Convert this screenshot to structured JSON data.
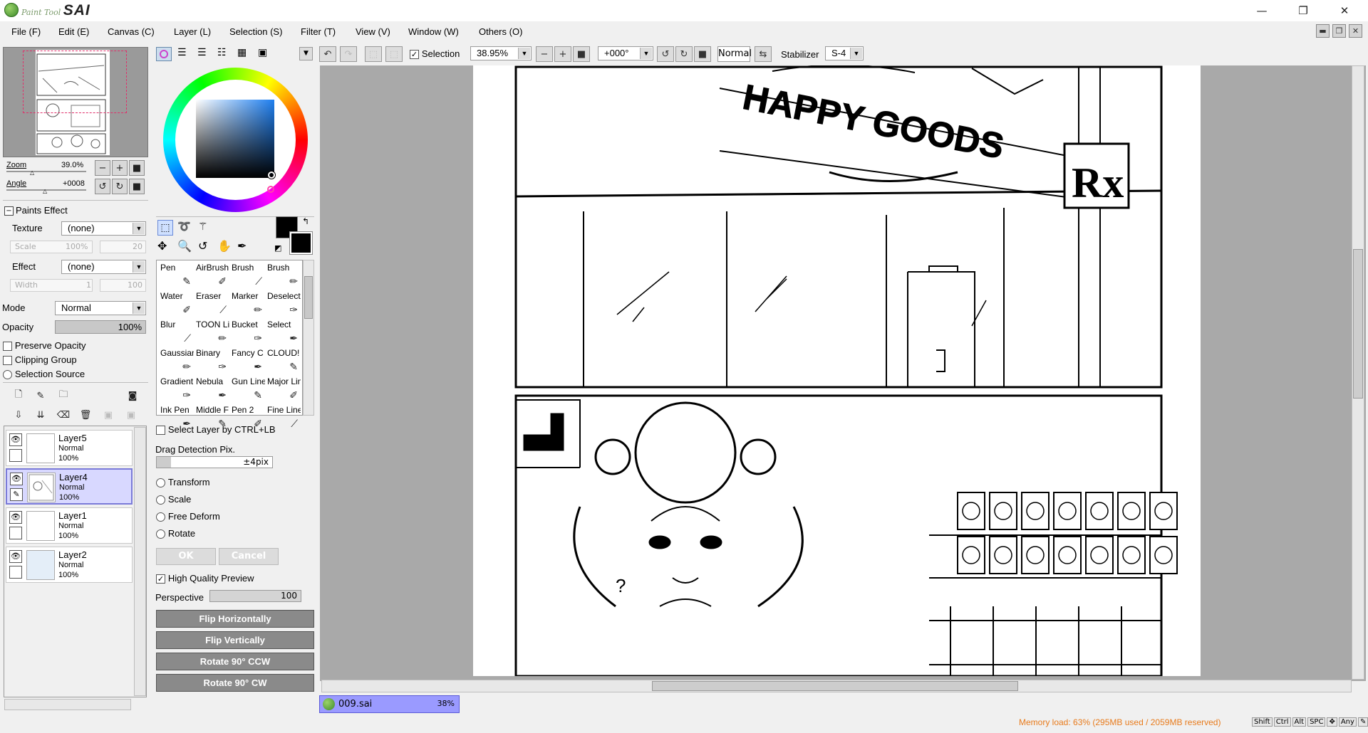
{
  "app": {
    "brand_small": "Paint Tool",
    "brand_big": "SAI"
  },
  "window_controls": {
    "minimize": "—",
    "restore": "❐",
    "close": "✕"
  },
  "menu": [
    "File (F)",
    "Edit (E)",
    "Canvas (C)",
    "Layer (L)",
    "Selection (S)",
    "Filter (T)",
    "View (V)",
    "Window (W)",
    "Others (O)"
  ],
  "navigator": {
    "zoom_label": "Zoom",
    "zoom_value": "39.0%",
    "angle_label": "Angle",
    "angle_value": "+0008"
  },
  "paints_effect": {
    "header": "Paints Effect",
    "texture_label": "Texture",
    "texture_value": "(none)",
    "scale_label": "Scale",
    "scale_value": "100%",
    "scale_num": "20",
    "effect_label": "Effect",
    "effect_value": "(none)",
    "width_label": "Width",
    "width_value": "1",
    "width_num": "100"
  },
  "layer_props": {
    "mode_label": "Mode",
    "mode_value": "Normal",
    "opacity_label": "Opacity",
    "opacity_value": "100%",
    "opacity_fraction": 1.0,
    "preserve_opacity": "Preserve Opacity",
    "clipping_group": "Clipping Group",
    "selection_source": "Selection Source"
  },
  "layers": [
    {
      "name": "Layer5",
      "mode": "Normal",
      "opacity": "100%",
      "selected": false
    },
    {
      "name": "Layer4",
      "mode": "Normal",
      "opacity": "100%",
      "selected": true
    },
    {
      "name": "Layer1",
      "mode": "Normal",
      "opacity": "100%",
      "selected": false
    },
    {
      "name": "Layer2",
      "mode": "Normal",
      "opacity": "100%",
      "selected": false
    }
  ],
  "tools": [
    [
      "Pen",
      "AirBrush",
      "Brush",
      "Brush"
    ],
    [
      "Water",
      "Eraser",
      "Marker",
      "Deselect"
    ],
    [
      "Blur",
      "TOON Linear",
      "Bucket",
      "Select"
    ],
    [
      "Gaussian",
      "Binary",
      "Fancy C",
      "CLOUD!"
    ],
    [
      "Gradient",
      "Nebula",
      "Gun Lines",
      "Major Line"
    ],
    [
      "Ink Pen",
      "Middle F",
      "Pen 2",
      "Fine Line"
    ]
  ],
  "tool_options": {
    "select_layer": "Select Layer by CTRL+LB",
    "drag_detection_label": "Drag Detection Pix.",
    "drag_detection_value": "±4pix",
    "transform": "Transform",
    "scale": "Scale",
    "free_deform": "Free Deform",
    "rotate": "Rotate",
    "ok": "OK",
    "cancel": "Cancel",
    "high_quality": "High Quality Preview",
    "perspective_label": "Perspective",
    "perspective_value": "100",
    "flip_h": "Flip Horizontally",
    "flip_v": "Flip Vertically",
    "rot_ccw": "Rotate 90° CCW",
    "rot_cw": "Rotate 90° CW"
  },
  "toolbar": {
    "selection_label": "Selection",
    "zoom_value": "38.95%",
    "angle_value": "+000°",
    "blend_value": "Normal",
    "stabilizer_label": "Stabilizer",
    "stabilizer_value": "S-4"
  },
  "canvas_art": {
    "sign_text": "HAPPY GOODS",
    "rx_text": "Rx",
    "question": "?"
  },
  "doc_tab": {
    "name": "009.sai",
    "zoom": "38%"
  },
  "status": {
    "memory": "Memory load: 63% (295MB used / 2059MB reserved)",
    "keys": [
      "Shift",
      "Ctrl",
      "Alt",
      "SPC",
      "Any"
    ]
  },
  "colors": {
    "accent": "#e87b1c",
    "selection": "#d8d8ff",
    "canvas_bg": "#a9a9a9"
  }
}
